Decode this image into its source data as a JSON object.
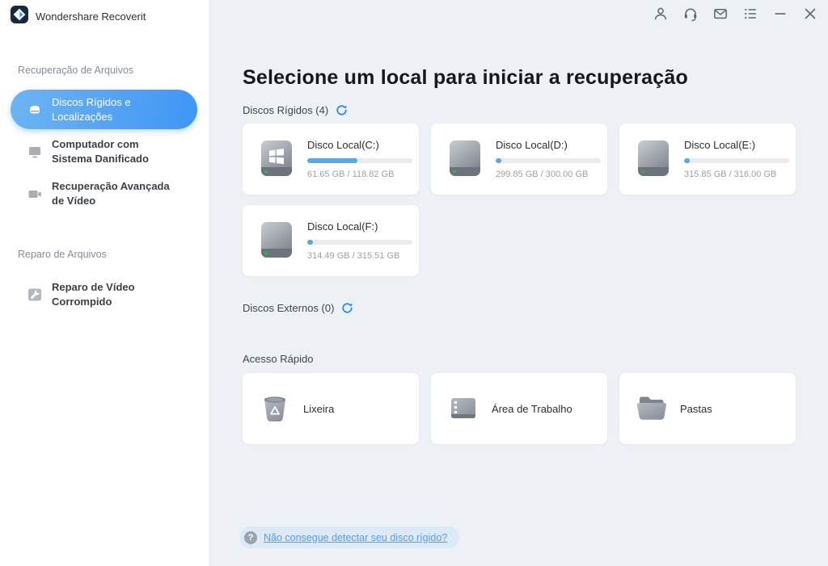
{
  "colors": {
    "accent_blue": "#3e96f5",
    "selected_gradient_start": "#6db4f3",
    "selected_gradient_end": "#3e96f5",
    "progress_fill": "#57a8e3",
    "link_blue": "#4b9ff2",
    "main_background": "#edf1f6",
    "help_pill_background": "#dceaf8"
  },
  "app": {
    "title": "Wondershare Recoverit"
  },
  "titlebar": {
    "icons": [
      {
        "name": "account-icon"
      },
      {
        "name": "support-headset-icon"
      },
      {
        "name": "feedback-mail-icon"
      },
      {
        "name": "menu-list-icon"
      },
      {
        "name": "minimize-icon"
      },
      {
        "name": "close-icon"
      }
    ]
  },
  "sidebar": {
    "sections": [
      {
        "label": "Recuperação de Arquivos",
        "items": [
          {
            "label": "Discos Rígidos e Localizações",
            "icon": "hard-drive-icon",
            "selected": true
          },
          {
            "label": "Computador com Sistema Danificado",
            "icon": "crashed-computer-icon",
            "selected": false
          },
          {
            "label": "Recuperação Avançada de Vídeo",
            "icon": "video-camera-icon",
            "selected": false
          }
        ]
      },
      {
        "label": "Reparo de Arquivos",
        "items": [
          {
            "label": "Reparo de Vídeo Corrompido",
            "icon": "repair-wrench-icon",
            "selected": false
          }
        ]
      }
    ]
  },
  "main": {
    "title": "Selecione um local para iniciar a recuperação",
    "hard_disks_label": "Discos Rígidos (4)",
    "external_disks_label": "Discos Externos (0)",
    "quick_access_label": "Acesso Rápido",
    "disks": [
      {
        "name": "Disco Local(C:)",
        "usage": "61.65 GB / 118.82 GB",
        "used_pct": "48%",
        "has_windows_logo": true
      },
      {
        "name": "Disco Local(D:)",
        "usage": "299.85 GB / 300.00 GB",
        "used_pct": "5%",
        "has_windows_logo": false
      },
      {
        "name": "Disco Local(E:)",
        "usage": "315.85 GB / 316.00 GB",
        "used_pct": "5%",
        "has_windows_logo": false
      },
      {
        "name": "Disco Local(F:)",
        "usage": "314.49 GB / 315.51 GB",
        "used_pct": "5%",
        "has_windows_logo": false
      }
    ],
    "quick_access": [
      {
        "label": "Lixeira",
        "icon": "recycle-bin-icon"
      },
      {
        "label": "Área de Trabalho",
        "icon": "desktop-icon"
      },
      {
        "label": "Pastas",
        "icon": "folder-icon"
      }
    ],
    "help": {
      "question_mark": "?",
      "link_text": "Não consegue detectar seu disco rígido?"
    }
  }
}
